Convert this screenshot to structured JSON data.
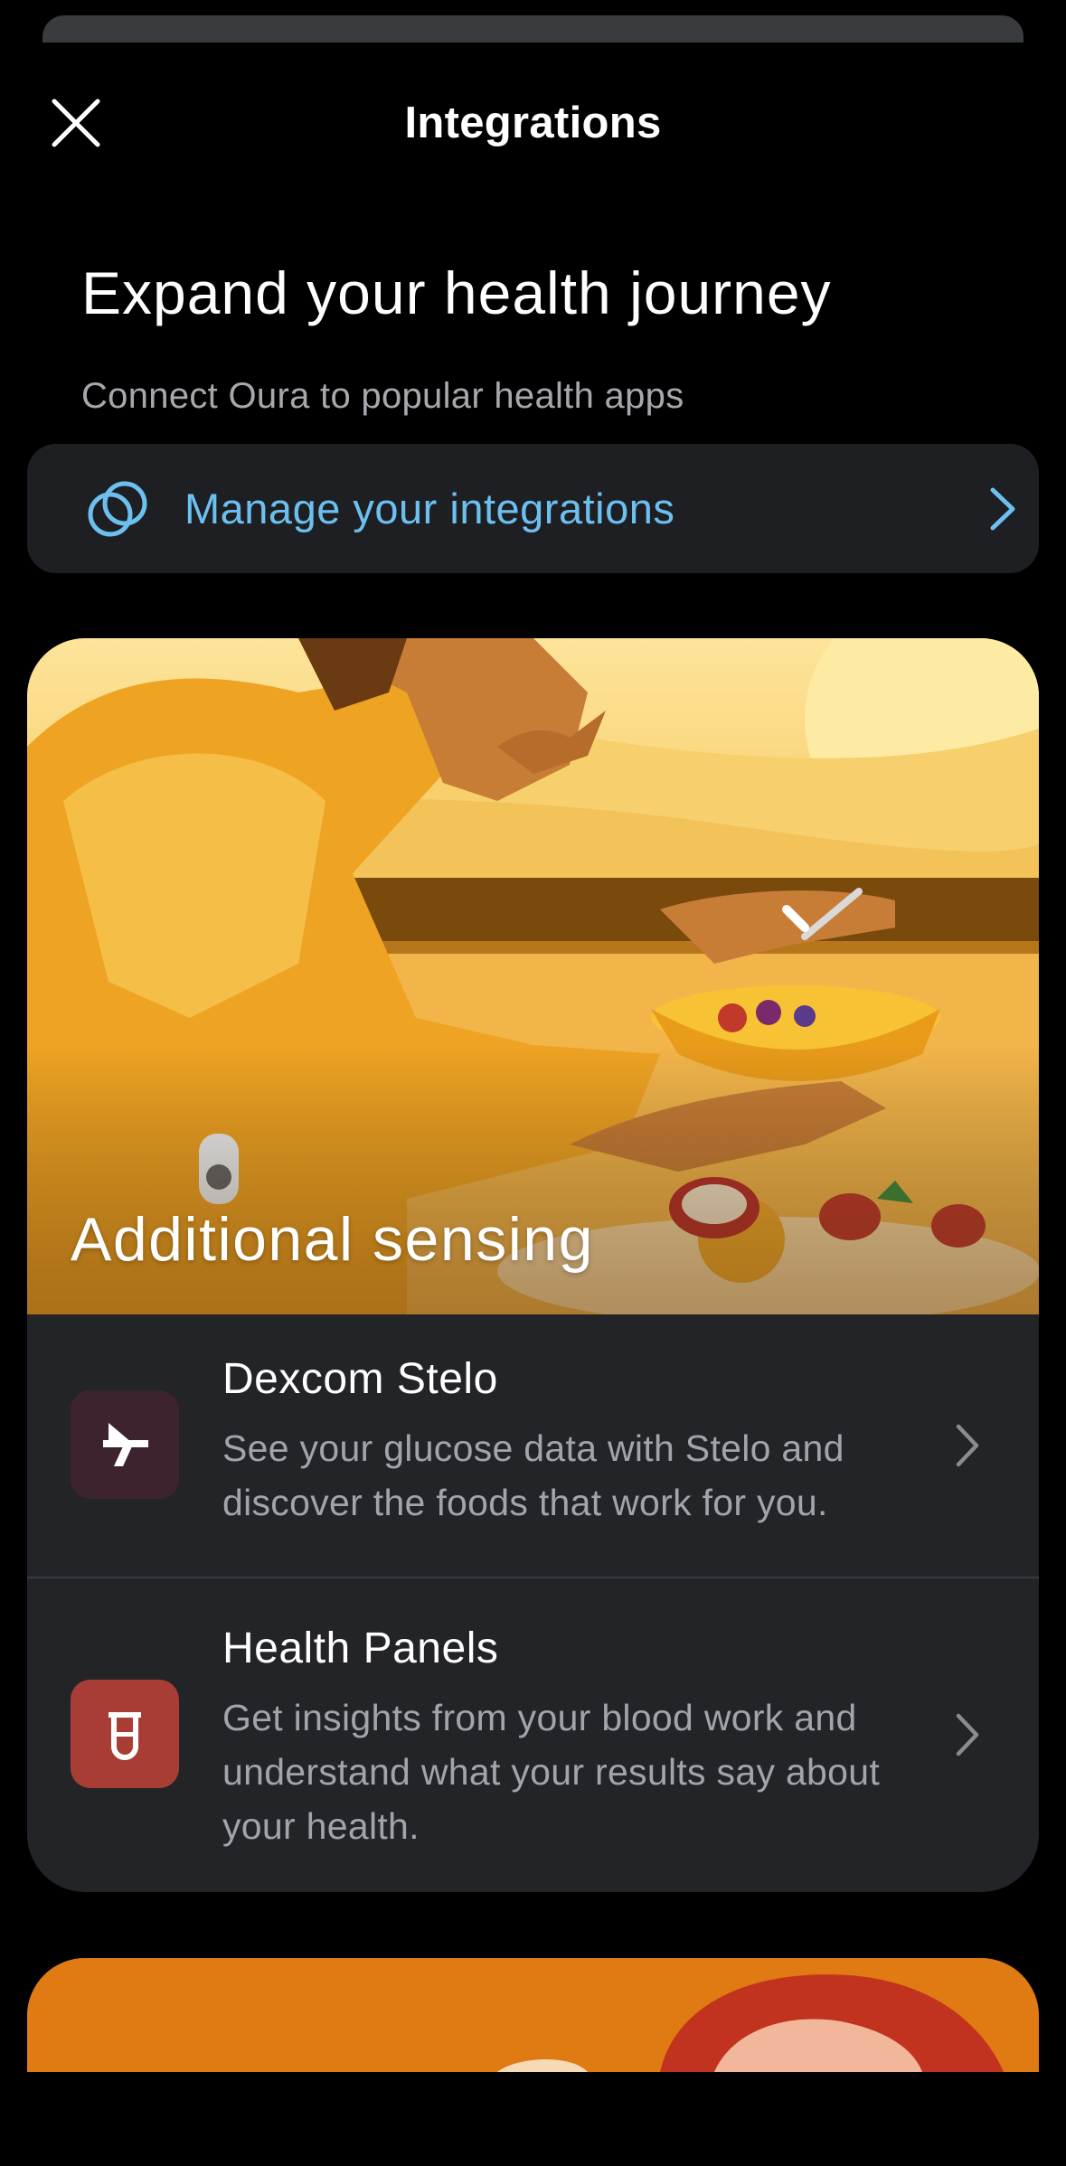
{
  "header": {
    "title": "Integrations",
    "close_icon": "close-icon"
  },
  "hero": {
    "title": "Expand your health journey",
    "subtitle": "Connect Oura to popular health apps"
  },
  "manage": {
    "label": "Manage your integrations",
    "icon": "linked-rings-icon",
    "accent": "#6cc0f0"
  },
  "section": {
    "banner_label": "Additional sensing",
    "items": [
      {
        "title": "Dexcom Stelo",
        "description": "See your glucose data with Stelo and discover the foods that work for you.",
        "icon": "stelo-logo-icon",
        "icon_bg": "#3d2330"
      },
      {
        "title": "Health Panels",
        "description": "Get insights from your blood work and understand what your results say about your health.",
        "icon": "test-tube-icon",
        "icon_bg": "#a83d35"
      }
    ]
  }
}
